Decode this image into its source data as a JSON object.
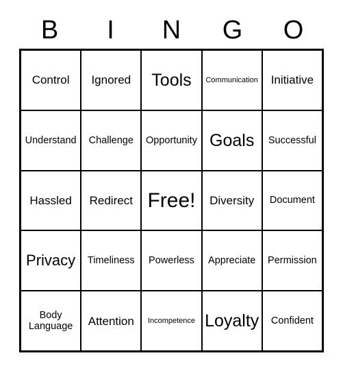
{
  "card": {
    "title": "BINGO card",
    "headers": [
      "B",
      "I",
      "N",
      "G",
      "O"
    ],
    "colors": {
      "background": "#ffffff",
      "border": "#000000",
      "text": "#000000"
    },
    "rows": [
      [
        {
          "label": "Control",
          "size": "m"
        },
        {
          "label": "Ignored",
          "size": "m"
        },
        {
          "label": "Tools",
          "size": "xl"
        },
        {
          "label": "Communication",
          "size": "xs"
        },
        {
          "label": "Initiative",
          "size": "m"
        }
      ],
      [
        {
          "label": "Understand",
          "size": "s"
        },
        {
          "label": "Challenge",
          "size": "s"
        },
        {
          "label": "Opportunity",
          "size": "s"
        },
        {
          "label": "Goals",
          "size": "xl"
        },
        {
          "label": "Successful",
          "size": "s"
        }
      ],
      [
        {
          "label": "Hassled",
          "size": "m"
        },
        {
          "label": "Redirect",
          "size": "m"
        },
        {
          "label": "Free!",
          "size": "xxl"
        },
        {
          "label": "Diversity",
          "size": "m"
        },
        {
          "label": "Document",
          "size": "s"
        }
      ],
      [
        {
          "label": "Privacy",
          "size": "l"
        },
        {
          "label": "Timeliness",
          "size": "s"
        },
        {
          "label": "Powerless",
          "size": "s"
        },
        {
          "label": "Appreciate",
          "size": "s"
        },
        {
          "label": "Permission",
          "size": "s"
        }
      ],
      [
        {
          "label": "Body Language",
          "size": "s"
        },
        {
          "label": "Attention",
          "size": "m"
        },
        {
          "label": "Incompetence",
          "size": "xs"
        },
        {
          "label": "Loyalty",
          "size": "xl"
        },
        {
          "label": "Confident",
          "size": "s"
        }
      ]
    ]
  }
}
